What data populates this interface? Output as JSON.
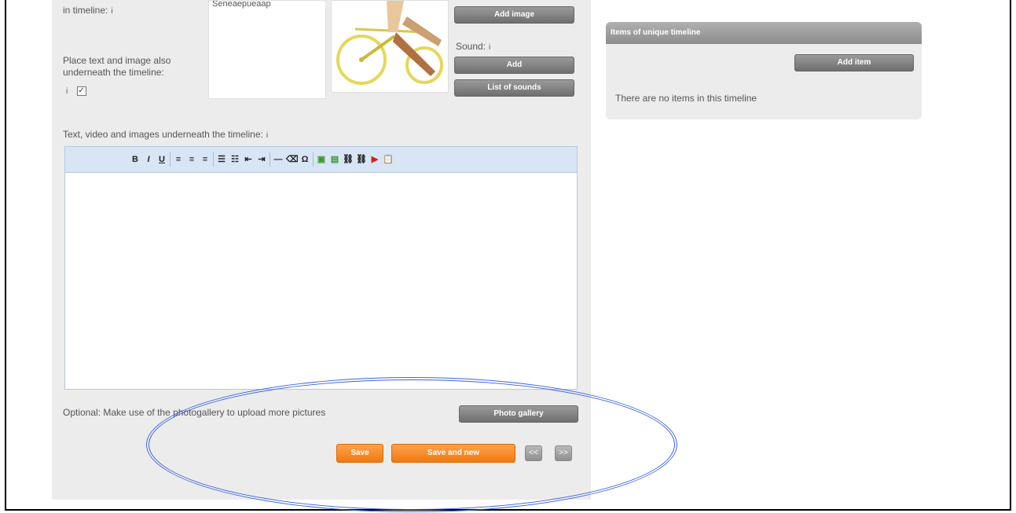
{
  "form": {
    "in_timeline_label": "in timeline:",
    "place_text_label": "Place text and image also underneath the timeline:",
    "checkbox_mark": "✓",
    "info_glyph": "i",
    "textarea_snippet": "Seneaepueaap",
    "add_image_label": "Add image",
    "sound_label": "Sound:",
    "add_sound_label": "Add",
    "list_of_sounds_label": "List of sounds",
    "underneath_label": "Text, video and images underneath the timeline:",
    "optional_label": "Optional: Make use of the photogallery to upload more pictures",
    "photo_gallery_label": "Photo gallery",
    "save_label": "Save",
    "save_and_new_label": "Save and new",
    "prev_label": "<<",
    "next_label": ">>"
  },
  "editor": {
    "toolbar_icons": [
      "bold-icon",
      "italic-icon",
      "underline-icon",
      "align-left-icon",
      "align-center-icon",
      "align-right-icon",
      "bullet-list-icon",
      "numbered-list-icon",
      "outdent-icon",
      "indent-icon",
      "horizontal-rule-icon",
      "clear-format-icon",
      "special-char-icon",
      "image-icon",
      "media-icon",
      "link-icon",
      "unlink-icon",
      "youtube-icon",
      "paste-icon"
    ],
    "toolbar_glyphs": [
      "B",
      "I",
      "U",
      "≡",
      "≡",
      "≡",
      "☰",
      "☷",
      "⇤",
      "⇥",
      "—",
      "⌫",
      "Ω",
      "▣",
      "▤",
      "⛓",
      "⛓",
      "▶",
      "📋"
    ]
  },
  "right_panel": {
    "header": "Items of unique timeline",
    "add_item_label": "Add item",
    "empty_text": "There are no items in this timeline"
  },
  "colors": {
    "orange": "#f07a10",
    "gray_button": "#7a7a7a",
    "editor_toolbar": "#d7e5f5",
    "highlight_ellipse": "#3a63e0"
  }
}
